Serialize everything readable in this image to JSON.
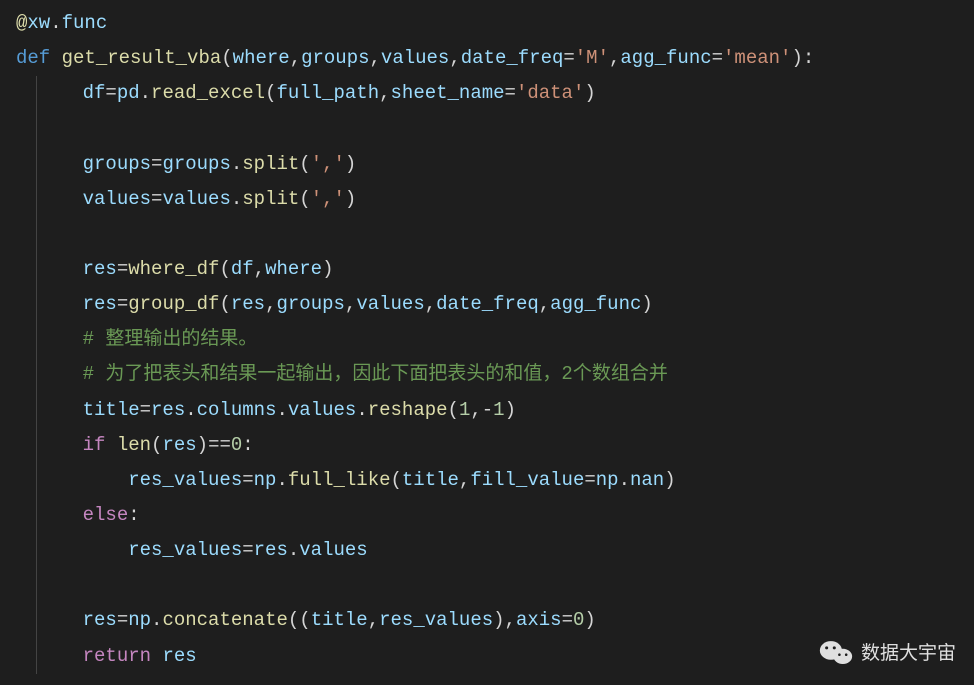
{
  "code": {
    "line1_decorator_at": "@",
    "line1_decorator_module": "xw",
    "line1_decorator_dot": ".",
    "line1_decorator_attr": "func",
    "line2_def": "def",
    "line2_fn": "get_result_vba",
    "line2_lp": "(",
    "line2_p1": "where",
    "line2_c1": ",",
    "line2_p2": "groups",
    "line2_c2": ",",
    "line2_p3": "values",
    "line2_c3": ",",
    "line2_p4": "date_freq",
    "line2_eq1": "=",
    "line2_s1": "'M'",
    "line2_c4": ",",
    "line2_p5": "agg_func",
    "line2_eq2": "=",
    "line2_s2": "'mean'",
    "line2_rp": "):",
    "line3_pre": "    ",
    "line3_v1": "df",
    "line3_eq": "=",
    "line3_mod": "pd",
    "line3_dot": ".",
    "line3_fn": "read_excel",
    "line3_lp": "(",
    "line3_a1": "full_path",
    "line3_c1": ",",
    "line3_a2": "sheet_name",
    "line3_eq2": "=",
    "line3_s1": "'data'",
    "line3_rp": ")",
    "line4_pre": "    ",
    "line5_pre": "    ",
    "line5_v1": "groups",
    "line5_eq": "=",
    "line5_v2": "groups",
    "line5_dot": ".",
    "line5_fn": "split",
    "line5_lp": "(",
    "line5_s1": "','",
    "line5_rp": ")",
    "line6_pre": "    ",
    "line6_v1": "values",
    "line6_eq": "=",
    "line6_v2": "values",
    "line6_dot": ".",
    "line6_fn": "split",
    "line6_lp": "(",
    "line6_s1": "','",
    "line6_rp": ")",
    "line7_pre": "    ",
    "line8_pre": "    ",
    "line8_v1": "res",
    "line8_eq": "=",
    "line8_fn": "where_df",
    "line8_lp": "(",
    "line8_a1": "df",
    "line8_c1": ",",
    "line8_a2": "where",
    "line8_rp": ")",
    "line9_pre": "    ",
    "line9_v1": "res",
    "line9_eq": "=",
    "line9_fn": "group_df",
    "line9_lp": "(",
    "line9_a1": "res",
    "line9_c1": ",",
    "line9_a2": "groups",
    "line9_c2": ",",
    "line9_a3": "values",
    "line9_c3": ",",
    "line9_a4": "date_freq",
    "line9_c4": ",",
    "line9_a5": "agg_func",
    "line9_rp": ")",
    "line10_pre": "    ",
    "line10_comment": "# 整理输出的结果。",
    "line11_pre": "    ",
    "line11_comment": "# 为了把表头和结果一起输出，因此下面把表头的和值，2个数组合并",
    "line12_pre": "    ",
    "line12_v1": "title",
    "line12_eq": "=",
    "line12_v2": "res",
    "line12_d1": ".",
    "line12_a1": "columns",
    "line12_d2": ".",
    "line12_a2": "values",
    "line12_d3": ".",
    "line12_fn": "reshape",
    "line12_lp": "(",
    "line12_n1": "1",
    "line12_c1": ",-",
    "line12_n2": "1",
    "line12_rp": ")",
    "line13_pre": "    ",
    "line13_if": "if",
    "line13_sp": " ",
    "line13_fn": "len",
    "line13_lp": "(",
    "line13_a1": "res",
    "line13_rp": ")==",
    "line13_n1": "0",
    "line13_col": ":",
    "line14_pre": "        ",
    "line14_v1": "res_values",
    "line14_eq": "=",
    "line14_mod": "np",
    "line14_dot": ".",
    "line14_fn": "full_like",
    "line14_lp": "(",
    "line14_a1": "title",
    "line14_c1": ",",
    "line14_a2": "fill_value",
    "line14_eq2": "=",
    "line14_mod2": "np",
    "line14_dot2": ".",
    "line14_a3": "nan",
    "line14_rp": ")",
    "line15_pre": "    ",
    "line15_else": "else",
    "line15_col": ":",
    "line16_pre": "        ",
    "line16_v1": "res_values",
    "line16_eq": "=",
    "line16_v2": "res",
    "line16_dot": ".",
    "line16_a1": "values",
    "line17_pre": "    ",
    "line18_pre": "    ",
    "line18_v1": "res",
    "line18_eq": "=",
    "line18_mod": "np",
    "line18_dot": ".",
    "line18_fn": "concatenate",
    "line18_lp": "((",
    "line18_a1": "title",
    "line18_c1": ",",
    "line18_a2": "res_values",
    "line18_rp1": "),",
    "line18_a3": "axis",
    "line18_eq2": "=",
    "line18_n1": "0",
    "line18_rp2": ")",
    "line19_pre": "    ",
    "line19_return": "return",
    "line19_sp": " ",
    "line19_v1": "res"
  },
  "watermark": {
    "text": "数据大宇宙"
  }
}
